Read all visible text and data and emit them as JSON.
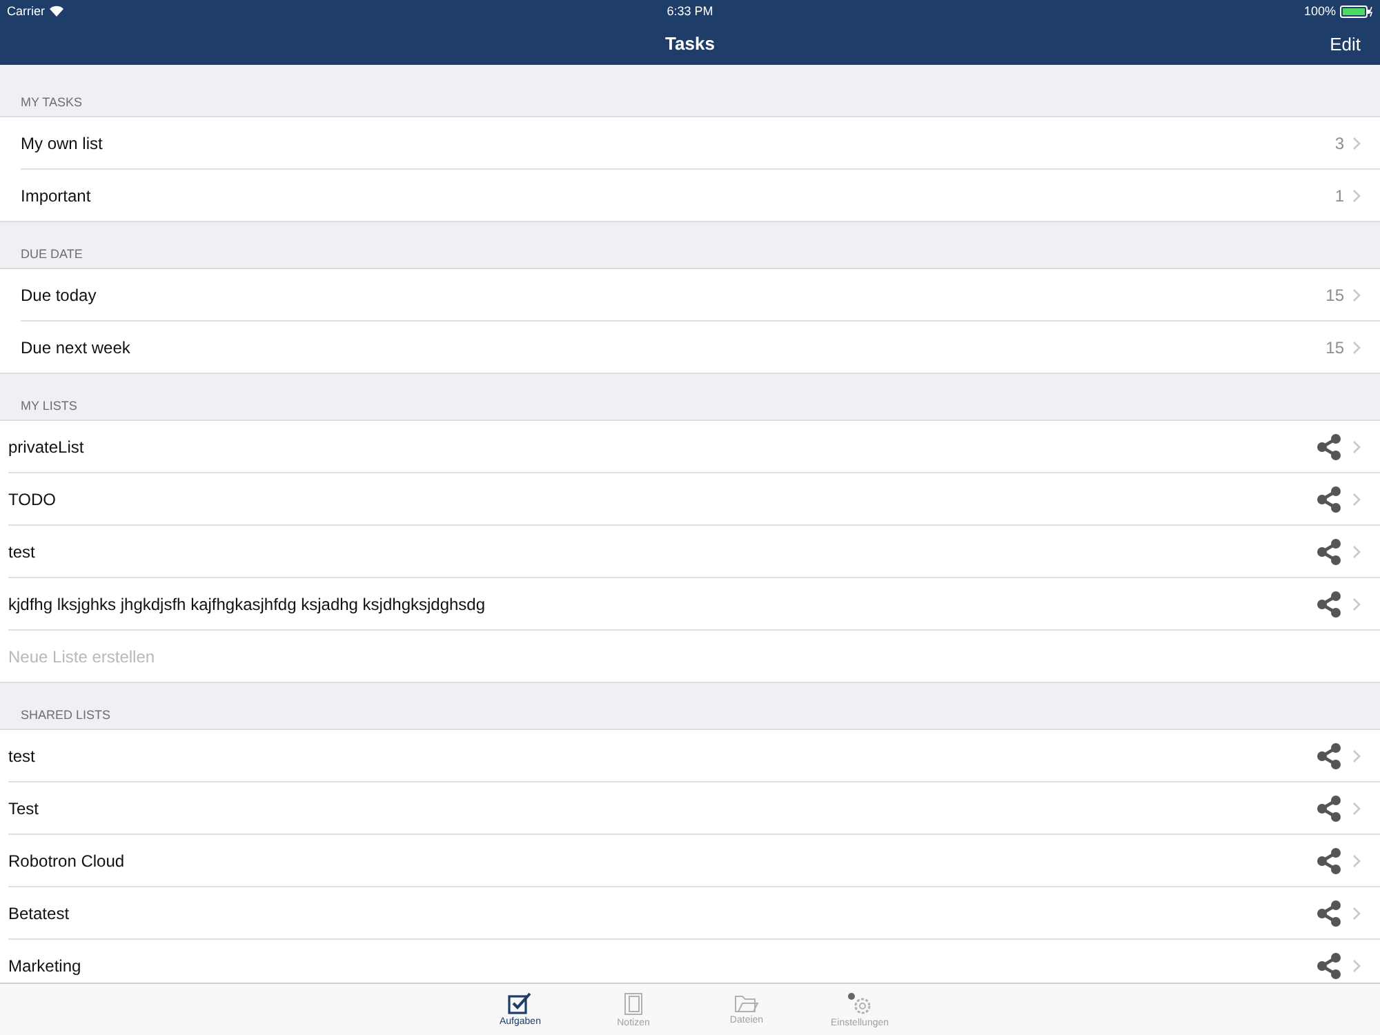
{
  "status_bar": {
    "carrier": "Carrier",
    "time": "6:33 PM",
    "battery": "100%"
  },
  "nav": {
    "title": "Tasks",
    "action": "Edit"
  },
  "sections": [
    {
      "header": "MY TASKS",
      "rows": [
        {
          "kind": "count",
          "label": "My own list",
          "count": "3"
        },
        {
          "kind": "count",
          "label": "Important",
          "count": "1"
        }
      ]
    },
    {
      "header": "DUE DATE",
      "rows": [
        {
          "kind": "count",
          "label": "Due today",
          "count": "15"
        },
        {
          "kind": "count",
          "label": "Due next week",
          "count": "15"
        }
      ]
    },
    {
      "header": "MY LISTS",
      "rows": [
        {
          "kind": "list",
          "label": "privateList"
        },
        {
          "kind": "list",
          "label": "TODO"
        },
        {
          "kind": "list",
          "label": "test"
        },
        {
          "kind": "list",
          "label": "kjdfhg lksjghks jhgkdjsfh kajfhgkasjhfdg ksjadhg ksjdhgksjdghsdg"
        },
        {
          "kind": "create",
          "placeholder": "Neue Liste erstellen"
        }
      ]
    },
    {
      "header": "SHARED LISTS",
      "rows": [
        {
          "kind": "list",
          "label": "test"
        },
        {
          "kind": "list",
          "label": "Test"
        },
        {
          "kind": "list",
          "label": "Robotron Cloud"
        },
        {
          "kind": "list",
          "label": "Betatest"
        },
        {
          "kind": "list",
          "label": "Marketing"
        }
      ]
    }
  ],
  "tabs": [
    {
      "kind": "tasks",
      "label": "Aufgaben",
      "selected": true
    },
    {
      "kind": "notes",
      "label": "Notizen",
      "selected": false
    },
    {
      "kind": "files",
      "label": "Dateien",
      "selected": false
    },
    {
      "kind": "settings",
      "label": "Einstellungen",
      "selected": false
    }
  ]
}
